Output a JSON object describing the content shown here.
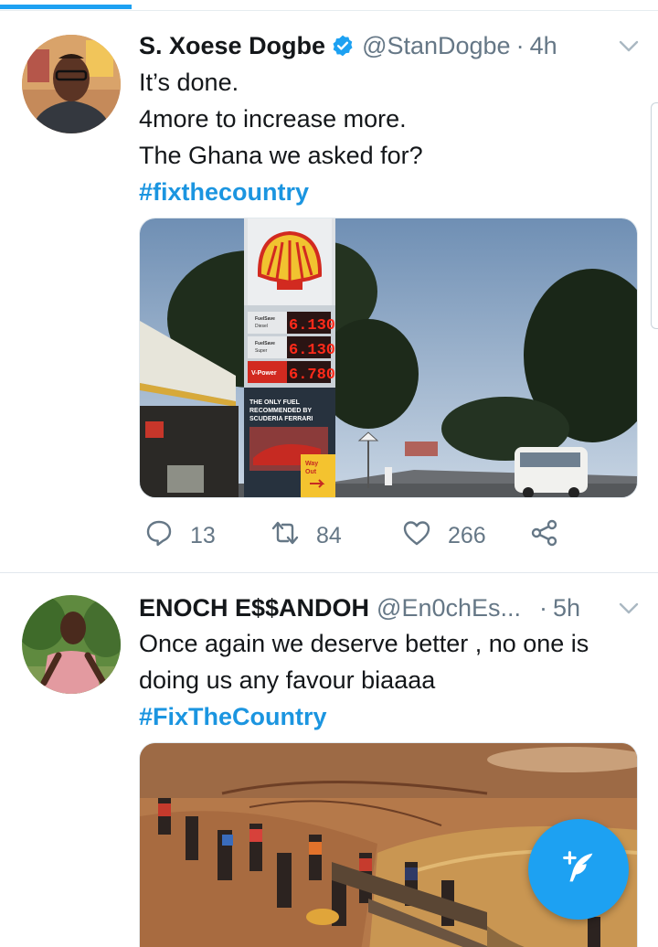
{
  "feed": {
    "tweets": [
      {
        "name": "S. Xoese Dogbe",
        "verified": true,
        "handle": "@StanDogbe",
        "separator": "·",
        "time": "4h",
        "lines": [
          "It’s done.",
          "4more to increase more.",
          "The Ghana we asked for?"
        ],
        "hashtag": "#fixthecountry",
        "media": {
          "price_rows": [
            {
              "label_top": "FuelSave",
              "label_bottom": "Diesel",
              "price": "6.130"
            },
            {
              "label_top": "FuelSave",
              "label_bottom": "Super",
              "price": "6.130"
            },
            {
              "label_top": "V-Power",
              "label_bottom": "",
              "price": "6.780"
            }
          ],
          "sign_caption": [
            "THE ONLY FUEL",
            "RECOMMENDED BY",
            "SCUDERIA FERRARI"
          ],
          "way_out": [
            "Way",
            "Out"
          ]
        },
        "actions": {
          "replies": "13",
          "retweets": "84",
          "likes": "266"
        }
      },
      {
        "name": "ENOCH E$$ANDOH",
        "verified": false,
        "handle": "@En0chEs...",
        "separator": "·",
        "time": "5h",
        "lines": [
          "Once again we deserve better , no one is",
          "doing us any favour biaaaa"
        ],
        "hashtag": "#FixTheCountry"
      }
    ]
  },
  "colors": {
    "accent": "#1da1f2",
    "hashtag": "#1b95e0",
    "secondary_text": "#657786",
    "price_red": "#ff2a1a"
  },
  "icons": {
    "reply": "reply-icon",
    "retweet": "retweet-icon",
    "like": "heart-icon",
    "share": "share-icon",
    "menu": "chevron-down-icon",
    "compose": "compose-tweet-icon"
  }
}
